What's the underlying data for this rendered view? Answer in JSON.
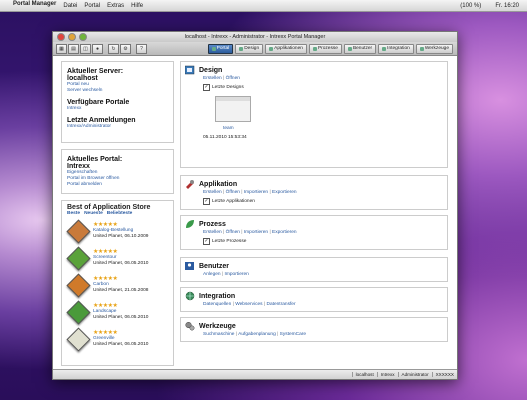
{
  "menubar": {
    "apple": "",
    "app_name": "Portal Manager",
    "items": [
      "Datei",
      "Portal",
      "Extras",
      "Hilfe"
    ],
    "status_items": [
      "(100 %)",
      "Fr. 16:20"
    ]
  },
  "window": {
    "title": "localhost - Intrexx - Administrator - Intrexx Portal Manager"
  },
  "tabs": [
    {
      "label": "Portal",
      "active": true
    },
    {
      "label": "Design"
    },
    {
      "label": "Applikationen"
    },
    {
      "label": "Prozesse"
    },
    {
      "label": "Benutzer"
    },
    {
      "label": "Integration"
    },
    {
      "label": "Werkzeuge"
    }
  ],
  "left": {
    "server_title": "Aktueller Server:",
    "server_name": "localhost",
    "server_links": [
      "Portal neu",
      "Server wechseln"
    ],
    "portals_title": "Verfügbare Portale",
    "portals_links": [
      "Intrexx"
    ],
    "logins_title": "Letzte Anmeldungen",
    "logins_links": [
      "Intrexx/Administrator"
    ],
    "current_portal_title": "Aktuelles Portal:",
    "current_portal_name": "Intrexx",
    "current_portal_links": [
      "Eigenschaften",
      "Portal im Browser öffnen",
      "Portal abmelden"
    ],
    "store_title": "Best of Application Store",
    "store_links": [
      "Beste",
      "Neueste",
      "Beliebteste"
    ],
    "store_apps": [
      {
        "stars": "★★★★★",
        "name": "Katalog-Bestellung",
        "vendor": "United Planet, 06.10.2009",
        "color": "#c97a3a"
      },
      {
        "stars": "★★★★★",
        "name": "Screentour",
        "vendor": "United Planet, 06.05.2010",
        "color": "#5aa23a"
      },
      {
        "stars": "★★★★★",
        "name": "Carbon",
        "vendor": "United Planet, 21.05.2008",
        "color": "#d07a2a"
      },
      {
        "stars": "★★★★★",
        "name": "Landscape",
        "vendor": "United Planet, 06.05.2010",
        "color": "#4a9a3a"
      },
      {
        "stars": "★★★★★",
        "name": "Greenville",
        "vendor": "United Planet, 06.05.2010",
        "color": "#e0e0d0"
      }
    ]
  },
  "right": {
    "design": {
      "title": "Design",
      "links": [
        "Erstellen",
        "Öffnen"
      ],
      "checkbox": "Letzte Designs",
      "thumb_name": "team",
      "date": "05.11.2010 15:53:34"
    },
    "applikation": {
      "title": "Applikation",
      "links": [
        "Erstellen",
        "Öffnen",
        "Importieren",
        "Exportieren"
      ],
      "checkbox": "Letzte Applikationen"
    },
    "prozess": {
      "title": "Prozess",
      "links": [
        "Erstellen",
        "Öffnen",
        "Importieren",
        "Exportieren"
      ],
      "checkbox": "Letzte Prozesse"
    },
    "benutzer": {
      "title": "Benutzer",
      "links": [
        "Anlegen",
        "Importieren"
      ]
    },
    "integration": {
      "title": "Integration",
      "links": [
        "Datenquellen",
        "Webservices",
        "Datentransfer"
      ]
    },
    "werkzeuge": {
      "title": "Werkzeuge",
      "links": [
        "Suchmaschine",
        "Aufgabenplanung",
        "SystemCare"
      ]
    }
  },
  "statusbar": {
    "items": [
      "localhost",
      "Intrexx",
      "Administrator",
      "XXXXXX"
    ]
  }
}
